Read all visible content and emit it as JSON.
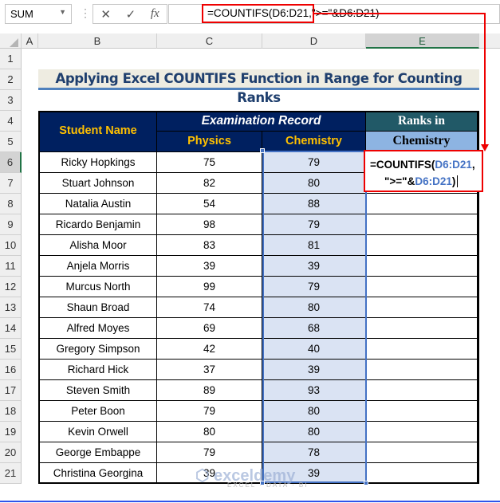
{
  "formula_bar": {
    "name_box": "SUM",
    "cancel_icon": "✕",
    "enter_icon": "✓",
    "fx_label": "fx",
    "formula": "=COUNTIFS(D6:D21,\">=\"&D6:D21)"
  },
  "columns": [
    "A",
    "B",
    "C",
    "D",
    "E"
  ],
  "rows": [
    "1",
    "2",
    "3",
    "4",
    "5",
    "6",
    "7",
    "8",
    "9",
    "10",
    "11",
    "12",
    "13",
    "14",
    "15",
    "16",
    "17",
    "18",
    "19",
    "20",
    "21"
  ],
  "title": "Applying Excel COUNTIFS Function in Range for Counting Ranks",
  "headers": {
    "student": "Student Name",
    "exam": "Examination Record",
    "physics": "Physics",
    "chemistry": "Chemistry",
    "ranks1": "Ranks in",
    "ranks2": "Chemistry"
  },
  "students": [
    [
      "Ricky Hopkings",
      75,
      79
    ],
    [
      "Stuart Johnson",
      82,
      80
    ],
    [
      "Natalia Austin",
      54,
      88
    ],
    [
      "Ricardo Benjamin",
      98,
      79
    ],
    [
      "Alisha Moor",
      83,
      81
    ],
    [
      "Anjela Morris",
      39,
      39
    ],
    [
      "Murcus North",
      99,
      79
    ],
    [
      "Shaun Broad",
      74,
      80
    ],
    [
      "Alfred Moyes",
      69,
      68
    ],
    [
      "Gregory Simpson",
      42,
      40
    ],
    [
      "Richard Hick",
      37,
      39
    ],
    [
      "Steven Smith",
      89,
      93
    ],
    [
      "Peter Boon",
      79,
      80
    ],
    [
      "Kevin Orwell",
      80,
      80
    ],
    [
      "George Embappe",
      79,
      78
    ],
    [
      "Christina Georgina",
      39,
      39
    ]
  ],
  "edit": {
    "p1": "=COUNTIFS(",
    "r1": "D6:D21",
    "p2": ",",
    "p3": "\">=\"&",
    "r2": "D6:D21",
    "p4": ")"
  },
  "watermark": {
    "name": "exceldemy",
    "tag": "EXCEL · DATA · BI"
  },
  "colors": {
    "header_bg": "#002060",
    "header_text": "#ffc000",
    "ranks_bg": "#215967",
    "ranks2_bg": "#8db4e2",
    "highlight": "#e00000",
    "selection": "#4472c4"
  }
}
